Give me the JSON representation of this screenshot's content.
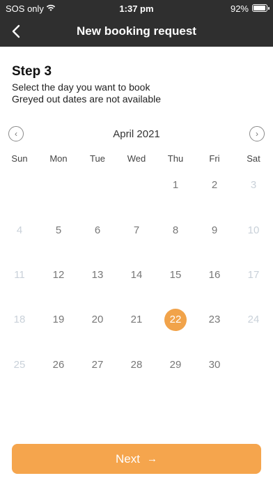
{
  "status_bar": {
    "carrier": "SOS only",
    "time": "1:37 pm",
    "battery": "92%"
  },
  "nav": {
    "title": "New booking request"
  },
  "step": {
    "heading": "Step 3",
    "line1": "Select the day you want to book",
    "line2": "Greyed out dates are not available"
  },
  "calendar": {
    "month_label": "April 2021",
    "weekdays": [
      "Sun",
      "Mon",
      "Tue",
      "Wed",
      "Thu",
      "Fri",
      "Sat"
    ],
    "weeks": [
      [
        "",
        "",
        "",
        "",
        "1",
        "2",
        "3"
      ],
      [
        "4",
        "5",
        "6",
        "7",
        "8",
        "9",
        "10"
      ],
      [
        "11",
        "12",
        "13",
        "14",
        "15",
        "16",
        "17"
      ],
      [
        "18",
        "19",
        "20",
        "21",
        "22",
        "23",
        "24"
      ],
      [
        "25",
        "26",
        "27",
        "28",
        "29",
        "30",
        ""
      ]
    ],
    "unavailable": [
      "3",
      "4",
      "10",
      "11",
      "17",
      "18",
      "24",
      "25"
    ],
    "selected": "22"
  },
  "actions": {
    "next_label": "Next",
    "next_icon": "→"
  },
  "colors": {
    "header_bg": "#2f2f2f",
    "accent": "#f5a54d",
    "unavailable_text": "#c9d1d9"
  }
}
